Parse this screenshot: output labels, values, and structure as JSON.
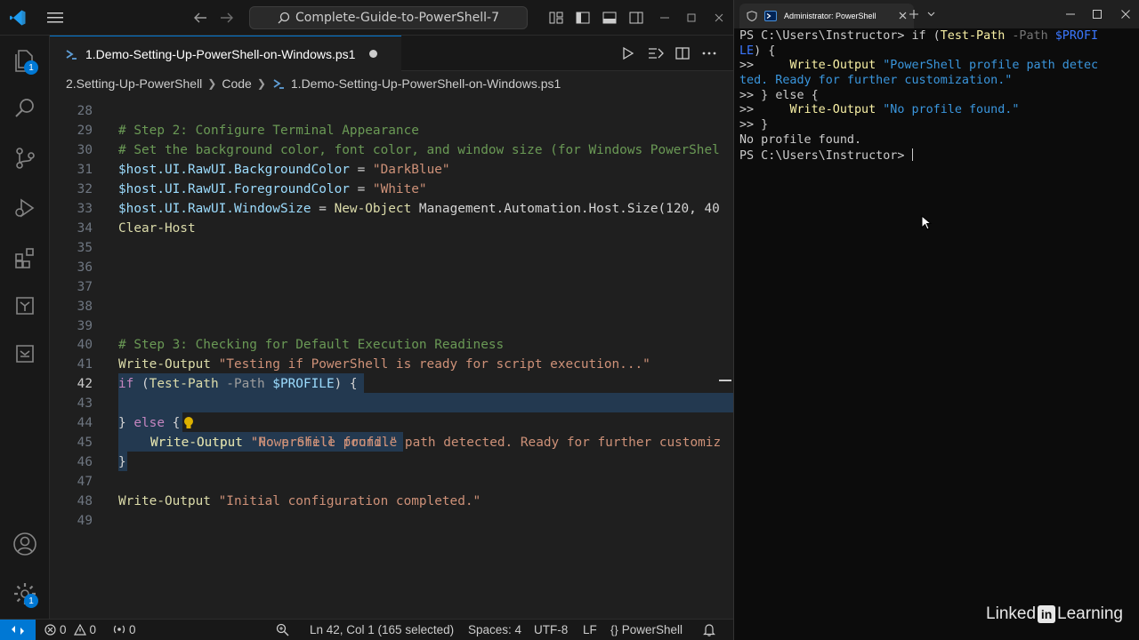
{
  "vscode": {
    "command_center": "Complete-Guide-to-PowerShell-7",
    "active_tab": "1.Demo-Setting-Up-PowerShell-on-Windows.ps1",
    "breadcrumb": [
      "2.Setting-Up-PowerShell",
      "Code",
      "1.Demo-Setting-Up-PowerShell-on-Windows.ps1"
    ],
    "badges": {
      "explorer": "1",
      "manage": "1"
    },
    "lines": [
      {
        "n": "28"
      },
      {
        "n": "29"
      },
      {
        "n": "30"
      },
      {
        "n": "31"
      },
      {
        "n": "32"
      },
      {
        "n": "33"
      },
      {
        "n": "34"
      },
      {
        "n": "35"
      },
      {
        "n": "36"
      },
      {
        "n": "37"
      },
      {
        "n": "38"
      },
      {
        "n": "39"
      },
      {
        "n": "40"
      },
      {
        "n": "41"
      },
      {
        "n": "42"
      },
      {
        "n": "43"
      },
      {
        "n": "44"
      },
      {
        "n": "45"
      },
      {
        "n": "46"
      },
      {
        "n": "47"
      },
      {
        "n": "48"
      },
      {
        "n": "49"
      }
    ],
    "code": {
      "l29": "# Step 2: Configure Terminal Appearance",
      "l30": "# Set the background color, font color, and window size (for Windows PowerShel",
      "l31_var": "$host.UI.RawUI.BackgroundColor",
      "l31_op": " = ",
      "l31_str": "\"DarkBlue\"",
      "l32_var": "$host.UI.RawUI.ForegroundColor",
      "l32_op": " = ",
      "l32_str": "\"White\"",
      "l33_var": "$host.UI.RawUI.WindowSize",
      "l33_op": " = ",
      "l33_cmd": "New-Object",
      "l33_rest": " Management.Automation.Host.Size(120, 40",
      "l34_cmd": "Clear-Host",
      "l40": "# Step 3: Checking for Default Execution Readiness",
      "l41_cmd": "Write-Output",
      "l41_str": " \"Testing if PowerShell is ready for script execution...\"",
      "l42_kw": "if",
      "l42_a": " (",
      "l42_cmd": "Test-Path",
      "l42_param": " -Path ",
      "l42_var": "$PROFILE",
      "l42_b": ") {",
      "l43_cmd": "Write-Output",
      "l43_str": " \"PowerShell profile path detected. Ready for further customiz",
      "l44_a": "} ",
      "l44_kw": "else",
      "l44_b": " {",
      "l45_cmd": "Write-Output",
      "l45_str": " \"No profile found.\"",
      "l46": "}",
      "l48_cmd": "Write-Output",
      "l48_str": " \"Initial configuration completed.\""
    },
    "status": {
      "errors": "0",
      "warnings": "0",
      "ports": "0",
      "position": "Ln 42, Col 1 (165 selected)",
      "spaces": "Spaces: 4",
      "encoding": "UTF-8",
      "eol": "LF",
      "language": "PowerShell"
    }
  },
  "terminal": {
    "tab_title": "Administrator: PowerShell",
    "prompt": "PS C:\\Users\\Instructor>",
    "cont": ">>",
    "l1_kw": "if",
    "l1_a": " (",
    "l1_cmd": "Test-Path",
    "l1_param": " -Path ",
    "l1_var": "$PROFI",
    "l2_var": "LE",
    "l2_b": ") {",
    "l3_cmd": "Write-Output",
    "l3_str": " \"PowerShell profile path detec",
    "l4_str": "ted. Ready for further customization.\"",
    "l5_a": " } ",
    "l5_kw": "else",
    "l5_b": " {",
    "l6_cmd": "Write-Output",
    "l6_str": " \"No profile found.\"",
    "l7": " }",
    "output": "No profile found.",
    "watermark_a": "Linked",
    "watermark_in": "in",
    "watermark_b": " Learning"
  }
}
